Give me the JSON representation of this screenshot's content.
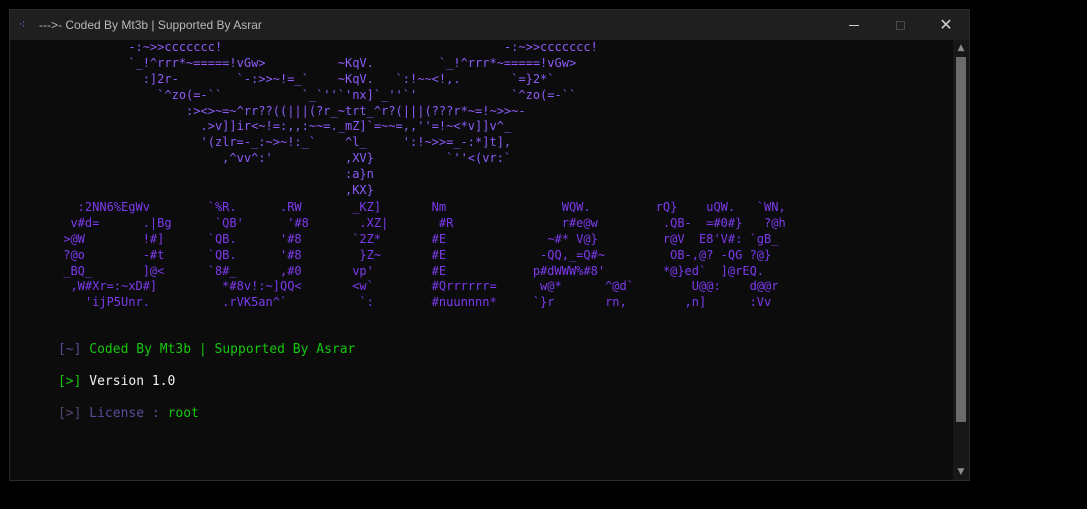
{
  "window": {
    "title": "--->- Coded By Mt3b | Supported By Asrar",
    "title_icon": "terminal-icon"
  },
  "controls": {
    "minimize_icon": "minimize-icon",
    "maximize_icon": "maximize-icon",
    "close_icon": "close-icon",
    "close_glyph": "✕"
  },
  "banner_top": [
    "          -:~>>ccccccc!                                       -:~>>ccccccc!",
    "          `_!^rrr*~=====!vGw>          ~KqV.         `_!^rrr*~=====!vGw>",
    "            :]2r-        `-:>>~!=_`    ~KqV.   `:!~~<!,.       `=}2*`",
    "              `^zo(=-``           `_`''`'nx]`_''`'             `^zo(=-``",
    "                  :><>~=~^rr??((|||(?r_~trt_^r?(|||(???r*~=!~>>~-",
    "                    .>v]]ir<~!=:,,:~~=._mZ]`=~~=,,''=!~<*v]]v^_",
    "                    '(zlr=-_:~>~!:_`    ^l_     ':!~>>=_-:*]t],",
    "                       ,^vv^:'          ,XV}          `''<(vr:`",
    "                                        :a}n",
    "                                        ,KX}"
  ],
  "banner_bottom": [
    "   :2NN6%EgWv        `%R.      .RW       _KZ]       Nm                WQW.         rQ}    uQW.   `WN,",
    "  v#d=      .|Bg      `QB'      '#8       .XZ|       #R               r#e@w         .QB-  =#0#}   ?@h",
    " >@W        !#]      `QB.      '#8       `2Z*       #E              ~#* V@}         r@V  E8'V#: `gB_",
    " ?@o        -#t      `QB.      '#8        }Z~       #E             -QQ,_=Q#~         OB-,@? -QG ?@}",
    " _BQ_       ]@<      `8#_      ,#0       vp'        #E            p#dWWW%#8'        *@}ed`  ]@rEQ.",
    "  ,W#Xr=:~xD#]         *#8v!:~]QQ<       <w`        #Qrrrrrr=      w@*      ^@d`        U@@:    d@@r",
    "    'ijP5Unr.          .rVK5an^`          `:        #nuunnnn*     `}r       rn,        ,n]      :Vv"
  ],
  "lines": {
    "coded": {
      "prefix": "[~]",
      "text": "Coded By Mt3b | Supported By Asrar"
    },
    "version": {
      "prefix": "[>]",
      "text": "Version 1.0"
    },
    "license": {
      "prefix": "[>]",
      "label": "License :",
      "value": "root"
    }
  },
  "scrollbar": {
    "up_icon": "scroll-up-icon",
    "down_icon": "scroll-down-icon",
    "up_glyph": "▲",
    "down_glyph": "▼"
  }
}
